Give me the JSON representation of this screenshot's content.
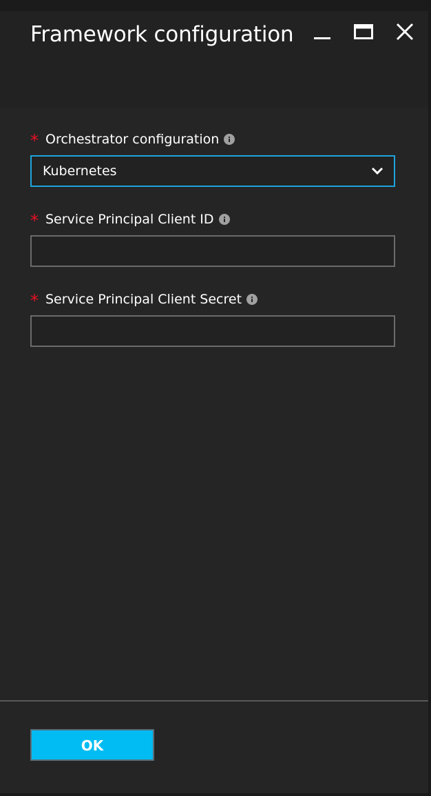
{
  "blade": {
    "title": "Framework configuration",
    "controls": {
      "minimize_icon": "minimize-icon",
      "maximize_icon": "maximize-icon",
      "close_icon": "close-icon"
    }
  },
  "form": {
    "required_marker": "*",
    "orchestrator": {
      "label": "Orchestrator configuration",
      "selected": "Kubernetes",
      "info_icon": "info-icon"
    },
    "client_id": {
      "label": "Service Principal Client ID",
      "value": "",
      "placeholder": "",
      "info_icon": "info-icon"
    },
    "client_secret": {
      "label": "Service Principal Client Secret",
      "value": "",
      "placeholder": "",
      "info_icon": "info-icon"
    }
  },
  "footer": {
    "ok_label": "OK"
  },
  "colors": {
    "background": "#252525",
    "header": "#222222",
    "accent": "#00bcf2",
    "focus_border": "#1fa3dc",
    "required": "#e81123",
    "input_border": "#6b6b6b"
  }
}
